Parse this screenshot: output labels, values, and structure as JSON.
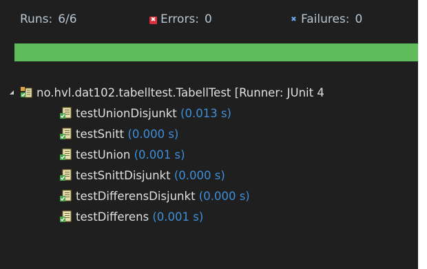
{
  "summary": {
    "runs_label": "Runs:",
    "runs_value": "6/6",
    "errors_label": "Errors:",
    "errors_value": "0",
    "failures_label": "Failures:",
    "failures_value": "0"
  },
  "progress": {
    "fraction": 1.0,
    "color": "#5ebd5a"
  },
  "tree": {
    "root": {
      "label": "no.hvl.dat102.tabelltest.TabellTest [Runner: JUnit 4",
      "icon": "test-suite-success-icon",
      "expanded": true
    },
    "tests": [
      {
        "name": "testUnionDisjunkt",
        "time": "(0.013 s)",
        "icon": "test-success-icon"
      },
      {
        "name": "testSnitt",
        "time": "(0.000 s)",
        "icon": "test-success-icon"
      },
      {
        "name": "testUnion",
        "time": "(0.001 s)",
        "icon": "test-success-icon"
      },
      {
        "name": "testSnittDisjunkt",
        "time": "(0.000 s)",
        "icon": "test-success-icon"
      },
      {
        "name": "testDifferensDisjunkt",
        "time": "(0.000 s)",
        "icon": "test-success-icon"
      },
      {
        "name": "testDifferens",
        "time": "(0.001 s)",
        "icon": "test-success-icon"
      }
    ]
  },
  "colors": {
    "background": "#1f1f1f",
    "text": "#e0e0e0",
    "time": "#3e8fd8",
    "success": "#5ebd5a",
    "error": "#d9303a",
    "failure": "#6ea9ea"
  }
}
